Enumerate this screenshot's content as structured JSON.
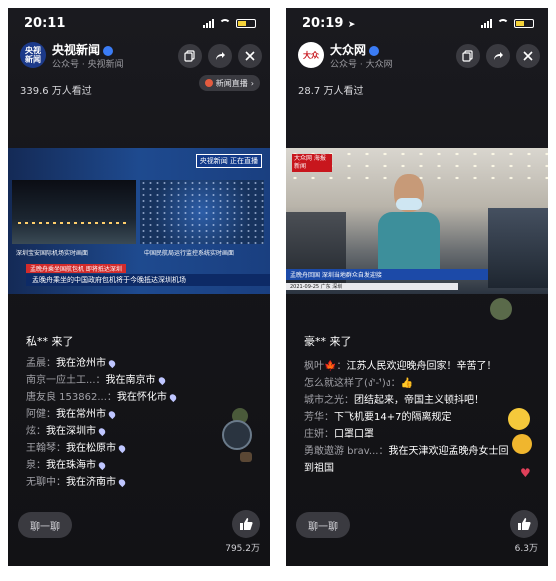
{
  "left": {
    "status": {
      "time": "20:11"
    },
    "account": {
      "name": "央视新闻",
      "subtitle": "公众号 · 央视新闻",
      "avatar_text": "央视\n新闻"
    },
    "viewers": "339.6 万人看过",
    "live_tag": "新闻直播",
    "video": {
      "badge": "央视新闻 正在直播",
      "cap_left": "深圳宝安国际机场实时画面",
      "cap_right": "中国民航局运行监控系统实时画面",
      "ticker1": "孟晚舟乘坐国航包机 即将抵达深圳",
      "ticker2": "孟晚舟乘坐的中国政府包机将于今晚抵达深圳机场"
    },
    "join_msg": "私** 来了",
    "chat": [
      {
        "user": "孟晨：",
        "msg": "我在沧州市"
      },
      {
        "user": "南京一应土工...：",
        "msg": "我在南京市"
      },
      {
        "user": "唐友良 153862...：",
        "msg": "我在怀化市"
      },
      {
        "user": "阿健：",
        "msg": "我在常州市"
      },
      {
        "user": "炫：",
        "msg": "我在深圳市"
      },
      {
        "user": "王翰琴：",
        "msg": "我在松原市"
      },
      {
        "user": "泉：",
        "msg": "我在珠海市"
      },
      {
        "user": "无聊中：",
        "msg": "我在济南市"
      }
    ],
    "bottom_button": "聊一聊",
    "like_count": "795.2万"
  },
  "right": {
    "status": {
      "time": "20:19"
    },
    "account": {
      "name": "大众网",
      "subtitle": "公众号 · 大众网",
      "avatar_text": "大众"
    },
    "viewers": "28.7 万人看过",
    "video": {
      "logo_text": "大众网 海报新闻",
      "ticker1": "孟晚舟回国 深圳当地群众自发迎接",
      "ticker2": "2021-09-25 广东 深圳"
    },
    "join_msg": "豪** 来了",
    "chat": [
      {
        "user": "枫叶🍁：",
        "msg": "江苏人民欢迎晚舟回家！辛苦了！"
      },
      {
        "user": "怎么就这样了(ง'̀-'́)ง：",
        "msg": "👍"
      },
      {
        "user": "城市之光：",
        "msg": "团结起来，帝国主义顿抖吧！"
      },
      {
        "user": "芳华：",
        "msg": "下飞机要14+7的隔离规定"
      },
      {
        "user": "庄妍：",
        "msg": "口罩口罩"
      },
      {
        "user": "勇敢遨游 brav...：",
        "msg": "我在天津欢迎孟晚舟女士回到祖国"
      }
    ],
    "bottom_button": "聊一聊",
    "like_count": "6.3万"
  }
}
